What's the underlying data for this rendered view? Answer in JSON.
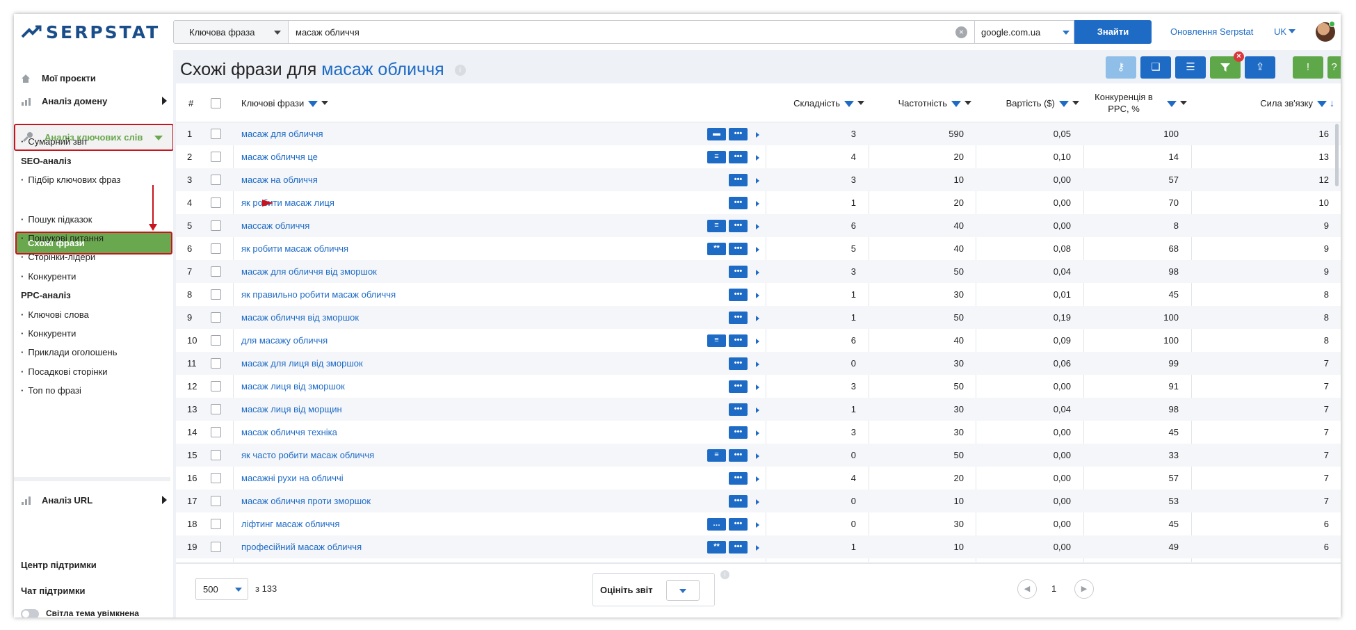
{
  "header": {
    "logo_text": "SERPSTAT",
    "search_type": "Ключова фраза",
    "query": "масаж обличчя",
    "engine": "google.com.ua",
    "search_button": "Знайти",
    "updates_link": "Оновлення Serpstat",
    "language": "UK"
  },
  "sidebar": {
    "my_projects": "Мої проєкти",
    "domain_analysis": "Аналіз домену",
    "keyword_analysis": "Аналіз ключових слів",
    "summary": "Сумарний звіт",
    "seo_head": "SEO-аналіз",
    "keyword_selection": "Підбір ключових фраз",
    "similar_phrases": "Схожі фрази",
    "search_suggestions": "Пошук підказок",
    "search_questions": "Пошукові питання",
    "top_pages": "Сторінки-лідери",
    "competitors": "Конкуренти",
    "ppc_head": "PPC-аналіз",
    "ppc_keywords": "Ключові слова",
    "ppc_competitors": "Конкуренти",
    "ad_examples": "Приклади оголошень",
    "landing_pages": "Посадкові сторінки",
    "top_by_phrase": "Топ по фразі",
    "url_analysis": "Аналіз URL",
    "support_center": "Центр підтримки",
    "support_chat": "Чат підтримки",
    "light_theme": "Світла тема увімкнена"
  },
  "page": {
    "title_prefix": "Схожі фрази для",
    "title_keyword": "масаж обличчя"
  },
  "table": {
    "headers": {
      "num": "#",
      "keywords": "Ключові фрази",
      "difficulty": "Складність",
      "frequency": "Частотність",
      "cost": "Вартість ($)",
      "ppc_competition": "Конкуренція в PPC, %",
      "relevance": "Сила зв'язку"
    },
    "rows": [
      {
        "n": "1",
        "kw": "масаж для обличчя",
        "icons": [
          "video",
          "dots"
        ],
        "d": "3",
        "f": "590",
        "c": "0,05",
        "p": "100",
        "s": "16"
      },
      {
        "n": "2",
        "kw": "масаж обличчя це",
        "icons": [
          "lines",
          "dots"
        ],
        "d": "4",
        "f": "20",
        "c": "0,10",
        "p": "14",
        "s": "13"
      },
      {
        "n": "3",
        "kw": "масаж на обличчя",
        "icons": [
          "dots"
        ],
        "d": "3",
        "f": "10",
        "c": "0,00",
        "p": "57",
        "s": "12"
      },
      {
        "n": "4",
        "kw": "як робити масаж лиця",
        "icons": [
          "dots"
        ],
        "d": "1",
        "f": "20",
        "c": "0,00",
        "p": "70",
        "s": "10"
      },
      {
        "n": "5",
        "kw": "массаж обличчя",
        "icons": [
          "lines",
          "dots"
        ],
        "d": "6",
        "f": "40",
        "c": "0,00",
        "p": "8",
        "s": "9"
      },
      {
        "n": "6",
        "kw": "як робити масаж обличчя",
        "icons": [
          "stars",
          "dots"
        ],
        "d": "5",
        "f": "40",
        "c": "0,08",
        "p": "68",
        "s": "9"
      },
      {
        "n": "7",
        "kw": "масаж для обличчя від зморшок",
        "icons": [
          "dots"
        ],
        "d": "3",
        "f": "50",
        "c": "0,04",
        "p": "98",
        "s": "9"
      },
      {
        "n": "8",
        "kw": "як правильно робити масаж обличчя",
        "icons": [
          "dots"
        ],
        "d": "1",
        "f": "30",
        "c": "0,01",
        "p": "45",
        "s": "8"
      },
      {
        "n": "9",
        "kw": "масаж обличчя від зморшок",
        "icons": [
          "dots"
        ],
        "d": "1",
        "f": "50",
        "c": "0,19",
        "p": "100",
        "s": "8"
      },
      {
        "n": "10",
        "kw": "для масажу обличчя",
        "icons": [
          "lines",
          "dots"
        ],
        "d": "6",
        "f": "40",
        "c": "0,09",
        "p": "100",
        "s": "8"
      },
      {
        "n": "11",
        "kw": "масаж для лиця від зморшок",
        "icons": [
          "dots"
        ],
        "d": "0",
        "f": "30",
        "c": "0,06",
        "p": "99",
        "s": "7"
      },
      {
        "n": "12",
        "kw": "масаж лиця від зморшок",
        "icons": [
          "dots"
        ],
        "d": "3",
        "f": "50",
        "c": "0,00",
        "p": "91",
        "s": "7"
      },
      {
        "n": "13",
        "kw": "масаж лиця від морщин",
        "icons": [
          "dots"
        ],
        "d": "1",
        "f": "30",
        "c": "0,04",
        "p": "98",
        "s": "7"
      },
      {
        "n": "14",
        "kw": "масаж обличчя техніка",
        "icons": [
          "dots"
        ],
        "d": "3",
        "f": "30",
        "c": "0,00",
        "p": "45",
        "s": "7"
      },
      {
        "n": "15",
        "kw": "як часто робити масаж обличчя",
        "icons": [
          "lines",
          "dots"
        ],
        "d": "0",
        "f": "50",
        "c": "0,00",
        "p": "33",
        "s": "7"
      },
      {
        "n": "16",
        "kw": "масажні рухи на обличчі",
        "icons": [
          "dots"
        ],
        "d": "4",
        "f": "20",
        "c": "0,00",
        "p": "57",
        "s": "7"
      },
      {
        "n": "17",
        "kw": "масаж обличчя проти зморшок",
        "icons": [
          "dots"
        ],
        "d": "0",
        "f": "10",
        "c": "0,00",
        "p": "53",
        "s": "7"
      },
      {
        "n": "18",
        "kw": "ліфтинг масаж обличчя",
        "icons": [
          "chat",
          "dots"
        ],
        "d": "0",
        "f": "30",
        "c": "0,00",
        "p": "45",
        "s": "6"
      },
      {
        "n": "19",
        "kw": "професійний масаж обличчя",
        "icons": [
          "stars",
          "dots"
        ],
        "d": "1",
        "f": "10",
        "c": "0,00",
        "p": "49",
        "s": "6"
      }
    ]
  },
  "footer": {
    "per_page": "500",
    "total": "з 133",
    "rate_report": "Оцініть звіт",
    "current_page": "1"
  }
}
